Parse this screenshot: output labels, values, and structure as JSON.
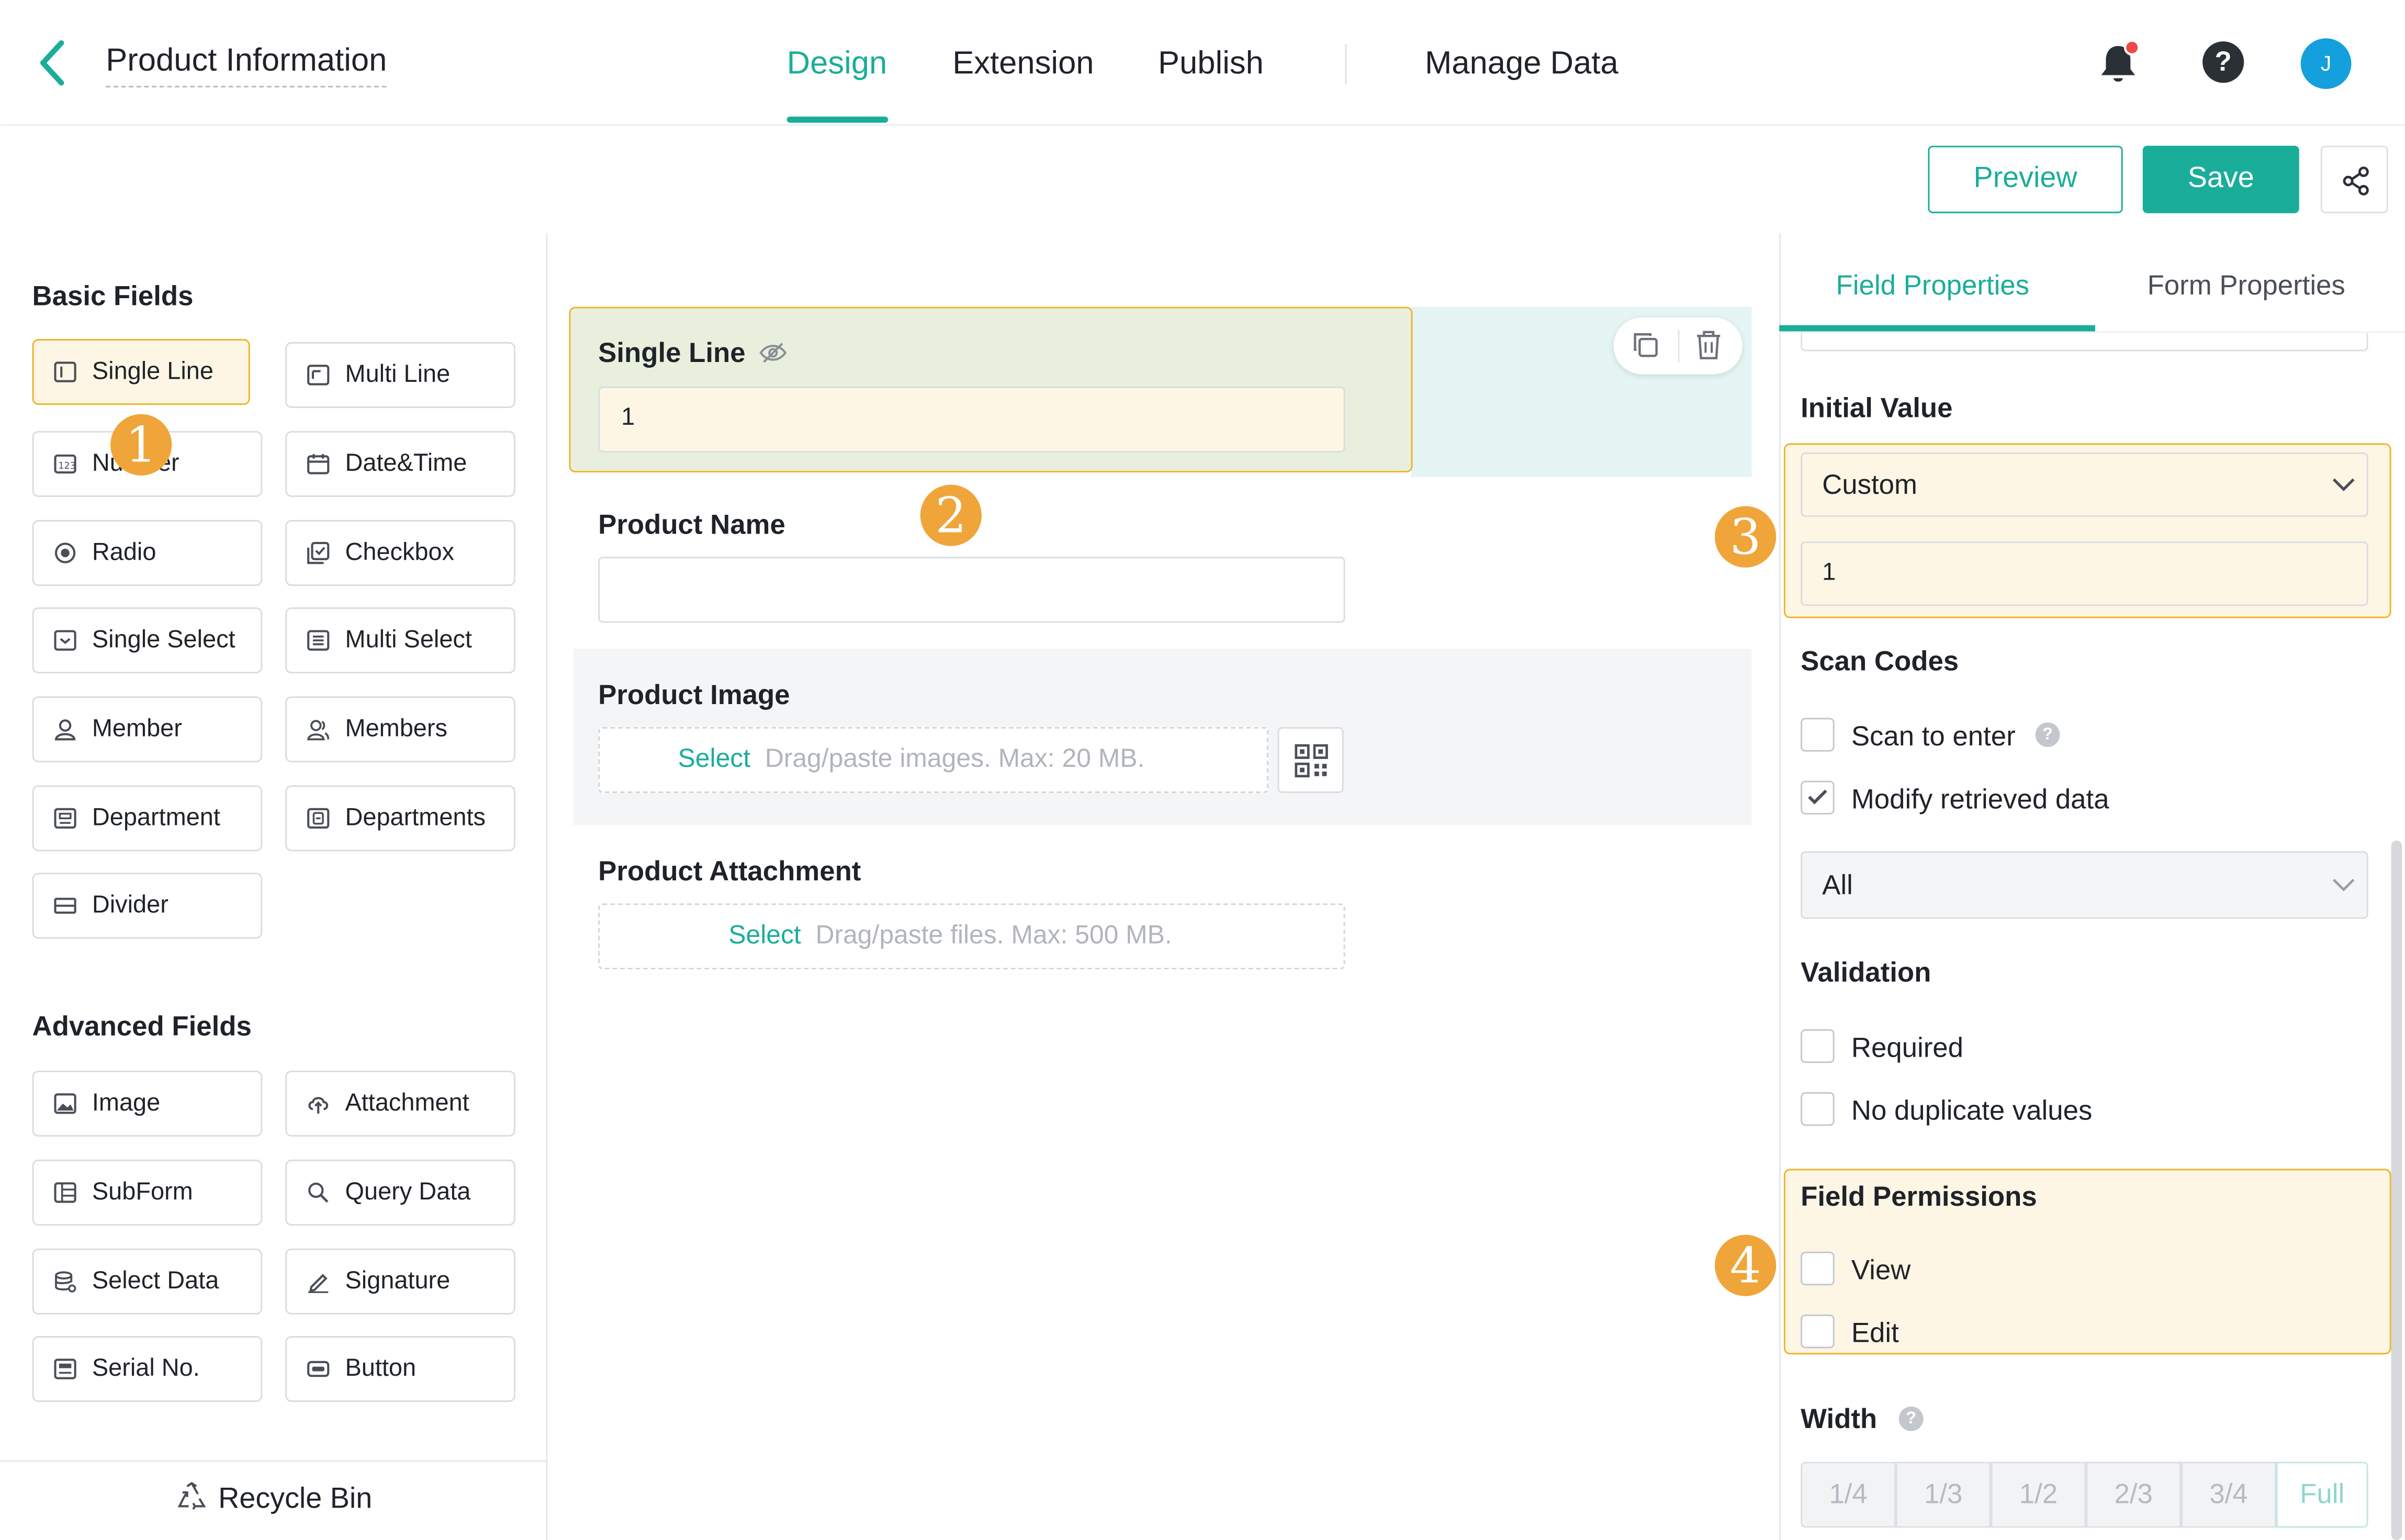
{
  "header": {
    "title": "Product Information",
    "tabs": [
      {
        "label": "Design",
        "active": true
      },
      {
        "label": "Extension"
      },
      {
        "label": "Publish"
      },
      {
        "label": "Manage Data"
      }
    ],
    "avatar_initial": "J",
    "help_glyph": "?"
  },
  "toolbar": {
    "preview_label": "Preview",
    "save_label": "Save"
  },
  "left_panel": {
    "basic_title": "Basic Fields",
    "basic_fields": [
      {
        "label": "Single Line",
        "icon": "single-line-icon"
      },
      {
        "label": "Multi Line",
        "icon": "multi-line-icon"
      },
      {
        "label": "Number",
        "icon": "number-icon"
      },
      {
        "label": "Date&Time",
        "icon": "calendar-icon"
      },
      {
        "label": "Radio",
        "icon": "radio-icon"
      },
      {
        "label": "Checkbox",
        "icon": "checkbox-icon"
      },
      {
        "label": "Single Select",
        "icon": "single-select-icon"
      },
      {
        "label": "Multi Select",
        "icon": "multi-select-icon"
      },
      {
        "label": "Member",
        "icon": "member-icon"
      },
      {
        "label": "Members",
        "icon": "members-icon"
      },
      {
        "label": "Department",
        "icon": "department-icon"
      },
      {
        "label": "Departments",
        "icon": "departments-icon"
      },
      {
        "label": "Divider",
        "icon": "divider-icon"
      }
    ],
    "advanced_title": "Advanced Fields",
    "advanced_fields": [
      {
        "label": "Image",
        "icon": "image-icon"
      },
      {
        "label": "Attachment",
        "icon": "upload-icon"
      },
      {
        "label": "SubForm",
        "icon": "subform-icon"
      },
      {
        "label": "Query Data",
        "icon": "query-icon"
      },
      {
        "label": "Select Data",
        "icon": "select-data-icon"
      },
      {
        "label": "Signature",
        "icon": "pen-icon"
      },
      {
        "label": "Serial No.",
        "icon": "serial-icon"
      },
      {
        "label": "Button",
        "icon": "button-icon"
      }
    ],
    "recycle_bin": "Recycle Bin"
  },
  "canvas": {
    "single_line": {
      "label": "Single Line",
      "value": "1"
    },
    "product_name": {
      "label": "Product Name",
      "value": ""
    },
    "product_image": {
      "label": "Product Image",
      "select": "Select",
      "hint": "Drag/paste images. Max: 20 MB."
    },
    "product_attachment": {
      "label": "Product Attachment",
      "select": "Select",
      "hint": "Drag/paste files. Max: 500 MB."
    }
  },
  "right_panel": {
    "tabs": [
      {
        "label": "Field Properties",
        "active": true
      },
      {
        "label": "Form Properties"
      }
    ],
    "initial_value": {
      "title": "Initial Value",
      "mode": "Custom",
      "value": "1"
    },
    "scan_codes": {
      "title": "Scan Codes",
      "scan_to_enter": {
        "label": "Scan to enter",
        "checked": false
      },
      "modify_retrieved": {
        "label": "Modify retrieved data",
        "checked": true
      },
      "scope": "All"
    },
    "validation": {
      "title": "Validation",
      "required": {
        "label": "Required",
        "checked": false
      },
      "no_duplicates": {
        "label": "No duplicate values",
        "checked": false
      }
    },
    "permissions": {
      "title": "Field Permissions",
      "view": {
        "label": "View",
        "checked": false
      },
      "edit": {
        "label": "Edit",
        "checked": false
      }
    },
    "width": {
      "title": "Width",
      "options": [
        "1/4",
        "1/3",
        "1/2",
        "2/3",
        "3/4",
        "Full"
      ],
      "selected": "Full"
    }
  },
  "annotations": [
    "1",
    "2",
    "3",
    "4"
  ],
  "colors": {
    "accent": "#1aad9a",
    "highlight_border": "#f0b429",
    "highlight_fill": "#fdf6e4",
    "badge": "#f0a53a",
    "notification_dot": "#f04848",
    "avatar": "#14a0dc"
  }
}
